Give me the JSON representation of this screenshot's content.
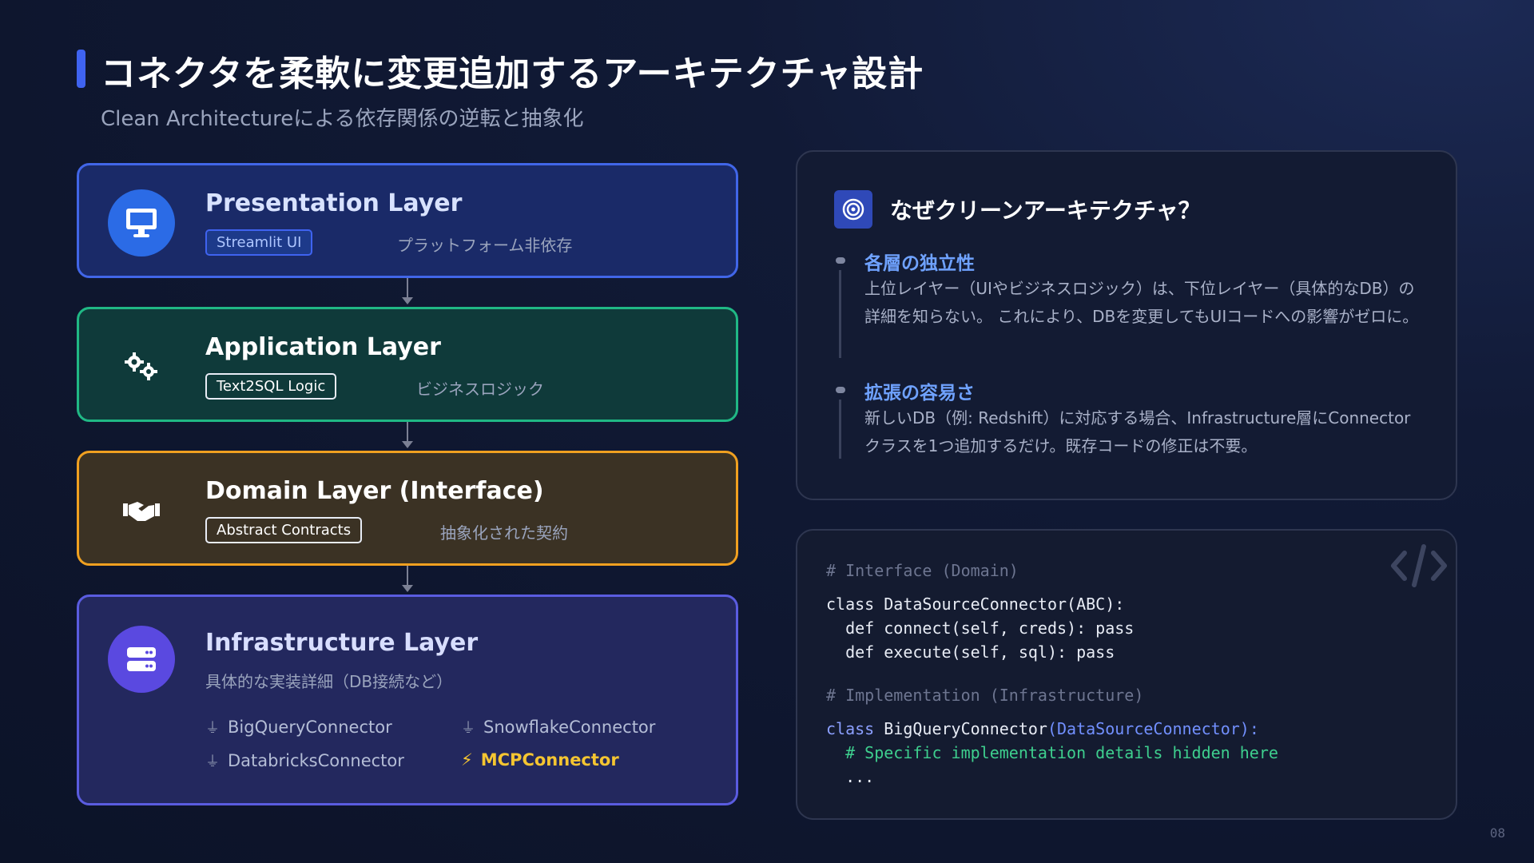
{
  "header": {
    "title": "コネクタを柔軟に変更追加するアーキテクチャ設計",
    "subtitle": "Clean Architectureによる依存関係の逆転と抽象化"
  },
  "layers": [
    {
      "name": "Presentation Layer",
      "tag": "Streamlit UI",
      "desc": "プラットフォーム非依存",
      "icon": "monitor-icon"
    },
    {
      "name": "Application Layer",
      "tag": "Text2SQL Logic",
      "desc": "ビジネスロジック",
      "icon": "gears-icon"
    },
    {
      "name": "Domain Layer (Interface)",
      "tag": "Abstract Contracts",
      "desc": "抽象化された契約",
      "icon": "handshake-icon"
    },
    {
      "name": "Infrastructure Layer",
      "desc": "具体的な実装詳細（DB接続など）",
      "icon": "server-icon",
      "connectors": [
        "BigQueryConnector",
        "SnowflakeConnector",
        "DatabricksConnector",
        "MCPConnector"
      ]
    }
  ],
  "why": {
    "heading": "なぜクリーンアーキテクチャ？",
    "points": [
      {
        "title": "各層の独立性",
        "text": "上位レイヤー（UIやビジネスロジック）は、下位レイヤー（具体的なDB）の詳細を知らない。 これにより、DBを変更してもUIコードへの影響がゼロに。"
      },
      {
        "title": "拡張の容易さ",
        "text": "新しいDB（例: Redshift）に対応する場合、Infrastructure層にConnectorクラスを1つ追加するだけ。既存コードの修正は不要。"
      }
    ]
  },
  "code": {
    "c1": "# Interface (Domain)",
    "l1": "class DataSourceConnector(ABC):",
    "l2": "  def connect(self, creds): pass",
    "l3": "  def execute(self, sql): pass",
    "c2": "# Implementation (Infrastructure)",
    "l4a": "class",
    "l4b": " BigQueryConnector",
    "l4c": "(DataSourceConnector):",
    "l5": "  # Specific implementation details hidden here",
    "l6": "  ..."
  },
  "page_number": "08",
  "colors": {
    "accent": "#3f63f0",
    "app": "#20b885",
    "domain": "#f0a020",
    "infra": "#5a5ce0",
    "highlight": "#f5c531"
  }
}
